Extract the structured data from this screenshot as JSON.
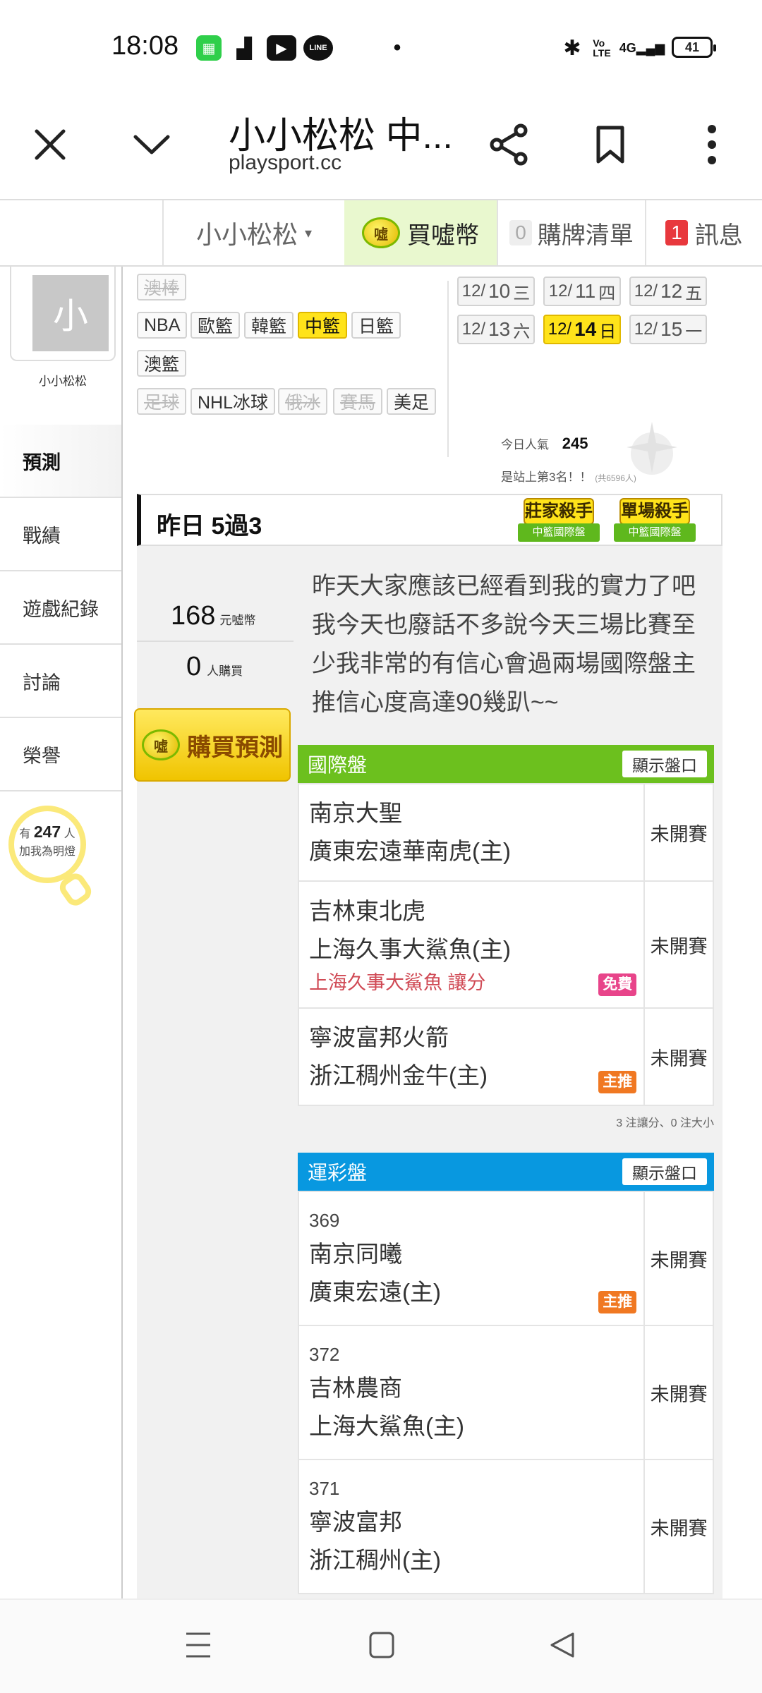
{
  "status_bar": {
    "time": "18:08",
    "battery": "41",
    "network": "4G"
  },
  "browser": {
    "title": "小小松松 中...",
    "url": "playsport.cc"
  },
  "site_nav": {
    "user_menu": "小小松松",
    "buy_coins": "買噓幣",
    "buy_list_count": "0",
    "buy_list": "購牌清單",
    "message_count": "1",
    "messages": "訊息"
  },
  "sidebar": {
    "avatar_char": "小",
    "username": "小小松松",
    "menu": [
      "預測",
      "戰績",
      "遊戲紀錄",
      "討論",
      "榮譽"
    ],
    "fans_prefix": "有",
    "fans_count": "247",
    "fans_suffix": "人",
    "fans_label": "加我為明燈"
  },
  "sports": {
    "tags": [
      "澳棒",
      "NBA",
      "歐籃",
      "韓籃",
      "中籃",
      "日籃",
      "澳籃",
      "足球",
      "NHL冰球",
      "俄冰",
      "賽馬",
      "美足"
    ],
    "selected": "中籃"
  },
  "dates": [
    {
      "m": "12/",
      "d": "10",
      "w": "三"
    },
    {
      "m": "12/",
      "d": "11",
      "w": "四"
    },
    {
      "m": "12/",
      "d": "12",
      "w": "五"
    },
    {
      "m": "12/",
      "d": "13",
      "w": "六"
    },
    {
      "m": "12/",
      "d": "14",
      "w": "日"
    },
    {
      "m": "12/",
      "d": "15",
      "w": "一"
    }
  ],
  "popularity": {
    "label": "今日人氣",
    "value": "245",
    "rank_text": "是站上第3名！！",
    "total": "(共6596人)"
  },
  "yesterday": {
    "title": "昨日 5過3",
    "badge1_top": "莊家殺手",
    "badge1_ribbon": "中籃國際盤",
    "badge2_top": "單場殺手",
    "badge2_ribbon": "中籃國際盤"
  },
  "stats": {
    "price": "168",
    "price_unit": "元噓幣",
    "buyers": "0",
    "buyers_unit": "人購買",
    "buy_button": "購買預測"
  },
  "description": "昨天大家應該已經看到我的實力了吧我今天也廢話不多說今天三場比賽至少我非常的有信心會過兩場國際盤主推信心度高達90幾趴~~",
  "international": {
    "title": "國際盤",
    "show_button": "顯示盤口",
    "games": [
      {
        "away": "南京大聖",
        "home": "廣東宏遠華南虎(主)",
        "status": "未開賽"
      },
      {
        "away": "吉林東北虎",
        "home": "上海久事大鯊魚(主)",
        "pick": "上海久事大鯊魚 讓分",
        "tag": "免費",
        "status": "未開賽"
      },
      {
        "away": "寧波富邦火箭",
        "home": "浙江稠州金牛(主)",
        "tag": "主推",
        "status": "未開賽"
      }
    ],
    "footnote": "3 注讓分、0 注大小"
  },
  "lottery": {
    "title": "運彩盤",
    "show_button": "顯示盤口",
    "games": [
      {
        "num": "369",
        "away": "南京同曦",
        "home": "廣東宏遠(主)",
        "tag": "主推",
        "status": "未開賽"
      },
      {
        "num": "372",
        "away": "吉林農商",
        "home": "上海大鯊魚(主)",
        "status": "未開賽"
      },
      {
        "num": "371",
        "away": "寧波富邦",
        "home": "浙江稠州(主)",
        "status": "未開賽"
      }
    ]
  },
  "colors": {
    "international": "#6cc01e",
    "lottery": "#0898e0",
    "highlight": "#ffe31a"
  }
}
